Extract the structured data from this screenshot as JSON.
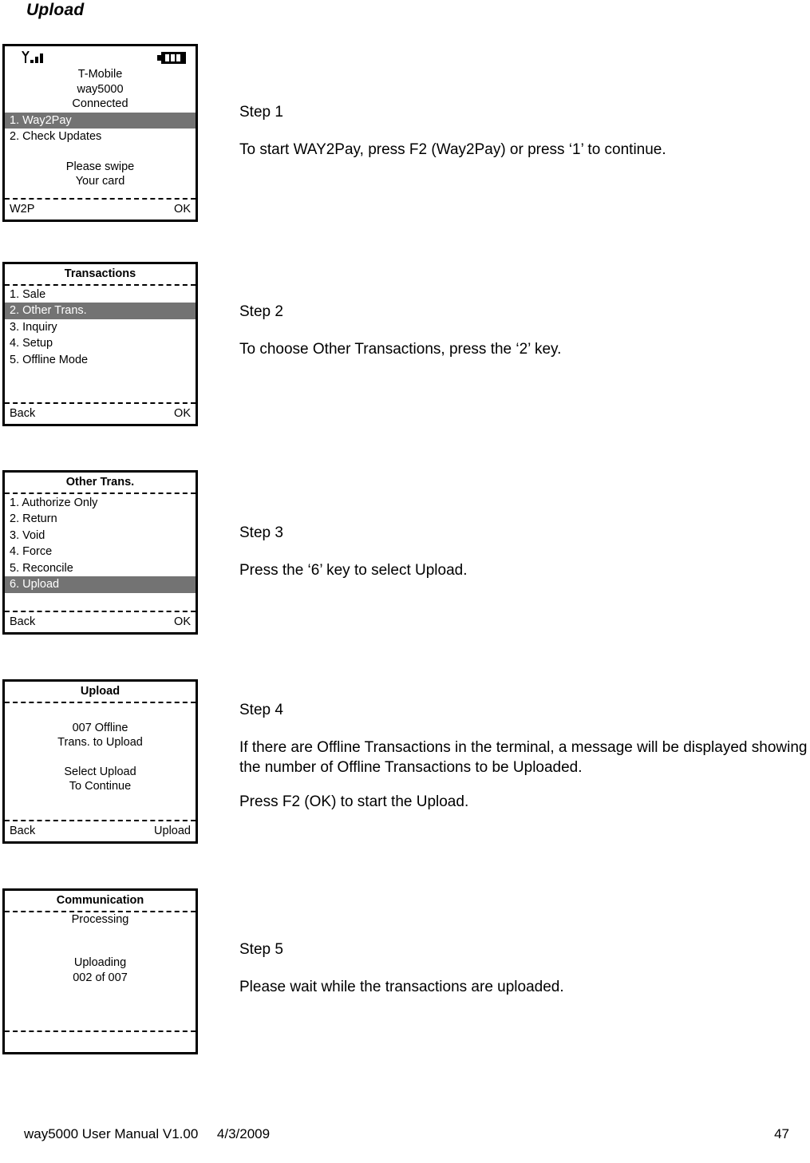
{
  "page": {
    "title": "Upload"
  },
  "screens": [
    {
      "id": "way2pay-home",
      "statusbar": {
        "signal_icon": "signal-bars-icon",
        "battery_icon": "battery-icon"
      },
      "header_lines": [
        "T-Mobile",
        "way5000",
        "Connected"
      ],
      "items": [
        {
          "label": "1. Way2Pay",
          "selected": true
        },
        {
          "label": "2. Check Updates",
          "selected": false
        }
      ],
      "message_lines": [
        "Please swipe",
        "Your card"
      ],
      "softkeys": {
        "left": "W2P",
        "right": "OK"
      }
    },
    {
      "id": "transactions",
      "title": "Transactions",
      "items": [
        {
          "label": "1. Sale",
          "selected": false
        },
        {
          "label": "2. Other Trans.",
          "selected": true
        },
        {
          "label": "3. Inquiry",
          "selected": false
        },
        {
          "label": "4. Setup",
          "selected": false
        },
        {
          "label": "5. Offline Mode",
          "selected": false
        }
      ],
      "softkeys": {
        "left": "Back",
        "right": "OK"
      }
    },
    {
      "id": "other-trans",
      "title": "Other Trans.",
      "items": [
        {
          "label": "1. Authorize Only",
          "selected": false
        },
        {
          "label": "2. Return",
          "selected": false
        },
        {
          "label": "3. Void",
          "selected": false
        },
        {
          "label": "4. Force",
          "selected": false
        },
        {
          "label": "5. Reconcile",
          "selected": false
        },
        {
          "label": "6. Upload",
          "selected": true
        }
      ],
      "softkeys": {
        "left": "Back",
        "right": "OK"
      }
    },
    {
      "id": "upload",
      "title": "Upload",
      "message_lines": [
        "007 Offline",
        "Trans. to Upload",
        "",
        "Select Upload",
        "To Continue"
      ],
      "softkeys": {
        "left": "Back",
        "right": "Upload"
      }
    },
    {
      "id": "communication",
      "title": "Communication",
      "message_lines": [
        "Processing",
        "",
        "",
        "Uploading",
        "002 of 007"
      ],
      "softkeys": {
        "left": "",
        "right": ""
      }
    }
  ],
  "steps": [
    {
      "label": "Step 1",
      "paragraphs": [
        "To start WAY2Pay, press F2 (Way2Pay) or press ‘1’ to continue."
      ]
    },
    {
      "label": "Step 2",
      "paragraphs": [
        "To choose Other Transactions, press the ‘2’ key."
      ]
    },
    {
      "label": "Step 3",
      "paragraphs": [
        "Press the ‘6’ key to select Upload."
      ]
    },
    {
      "label": "Step 4",
      "paragraphs": [
        "If there are Offline Transactions in the terminal, a message will be displayed showing the number of Offline Transactions to be Uploaded.",
        "Press F2 (OK) to start the Upload."
      ]
    },
    {
      "label": "Step 5",
      "paragraphs": [
        "Please wait while the transactions are uploaded."
      ]
    }
  ],
  "footer": {
    "left": "way5000 User Manual V1.00     4/3/2009",
    "page_number": "47"
  }
}
